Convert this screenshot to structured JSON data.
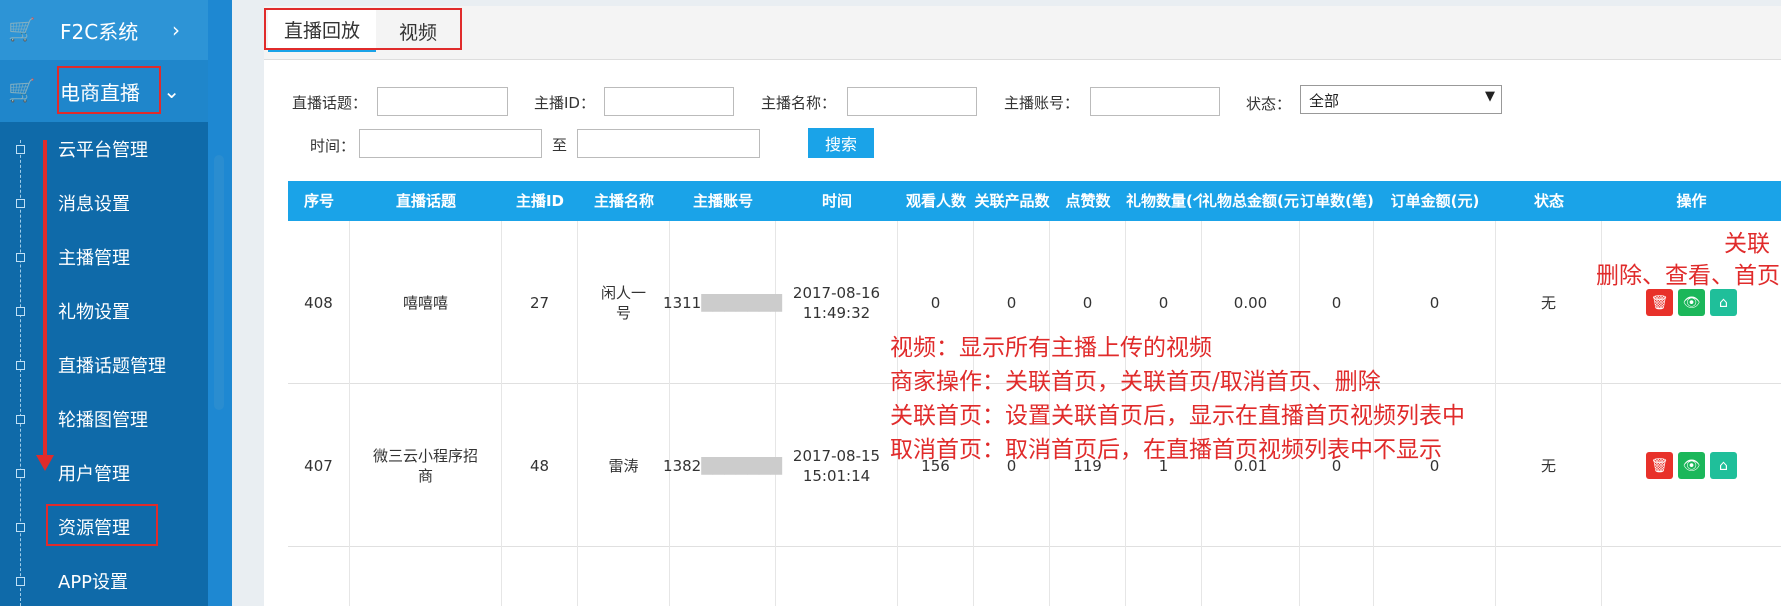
{
  "sidebar": {
    "main_items": [
      {
        "label": "F2C系统",
        "chevron": "›"
      },
      {
        "label": "电商直播",
        "chevron": "⌄"
      }
    ],
    "sub_items": [
      "云平台管理",
      "消息设置",
      "主播管理",
      "礼物设置",
      "直播话题管理",
      "轮播图管理",
      "用户管理",
      "资源管理",
      "APP设置"
    ]
  },
  "tabs": [
    "直播回放",
    "视频"
  ],
  "filters": {
    "topic_label": "直播话题：",
    "anchor_id_label": "主播ID：",
    "anchor_name_label": "主播名称：",
    "anchor_account_label": "主播账号：",
    "status_label": "状态：",
    "status_value": "全部",
    "time_label": "时间：",
    "to_label": "至",
    "search_button": "搜索"
  },
  "table": {
    "headers": [
      "序号",
      "直播话题",
      "主播ID",
      "主播名称",
      "主播账号",
      "时间",
      "观看人数",
      "关联产品数",
      "点赞数",
      "礼物数量(个)",
      "礼物总金额(元)",
      "订单数(笔)",
      "订单金额(元)",
      "状态",
      "操作"
    ],
    "rows": [
      {
        "id": "408",
        "topic": "嘻嘻嘻",
        "anchor_id": "27",
        "anchor_name": "闲人一号",
        "account": "1311",
        "time_date": "2017-08-16",
        "time_clock": "11:49:32",
        "viewers": "0",
        "products": "0",
        "likes": "0",
        "gifts": "0",
        "gift_amount": "0.00",
        "orders": "0",
        "order_amount": "0",
        "status": "无"
      },
      {
        "id": "407",
        "topic": "微三云小程序招商",
        "anchor_id": "48",
        "anchor_name": "雷涛",
        "account": "1382",
        "time_date": "2017-08-15",
        "time_clock": "15:01:14",
        "viewers": "156",
        "products": "0",
        "likes": "119",
        "gifts": "1",
        "gift_amount": "0.01",
        "orders": "0",
        "order_amount": "0",
        "status": "无"
      }
    ]
  },
  "annotations": {
    "ops_title": "关联",
    "ops_desc": "删除、查看、首页",
    "lines": [
      "视频：显示所有主播上传的视频",
      "商家操作：关联首页，关联首页/取消首页、删除",
      "关联首页：设置关联首页后，显示在直播首页视频列表中",
      "取消首页：取消首页后，在直播首页视频列表中不显示"
    ]
  },
  "colors": {
    "accent": "#1aa3e8",
    "sidebar": "#1a7cc0",
    "annotation": "#e02b2b"
  }
}
